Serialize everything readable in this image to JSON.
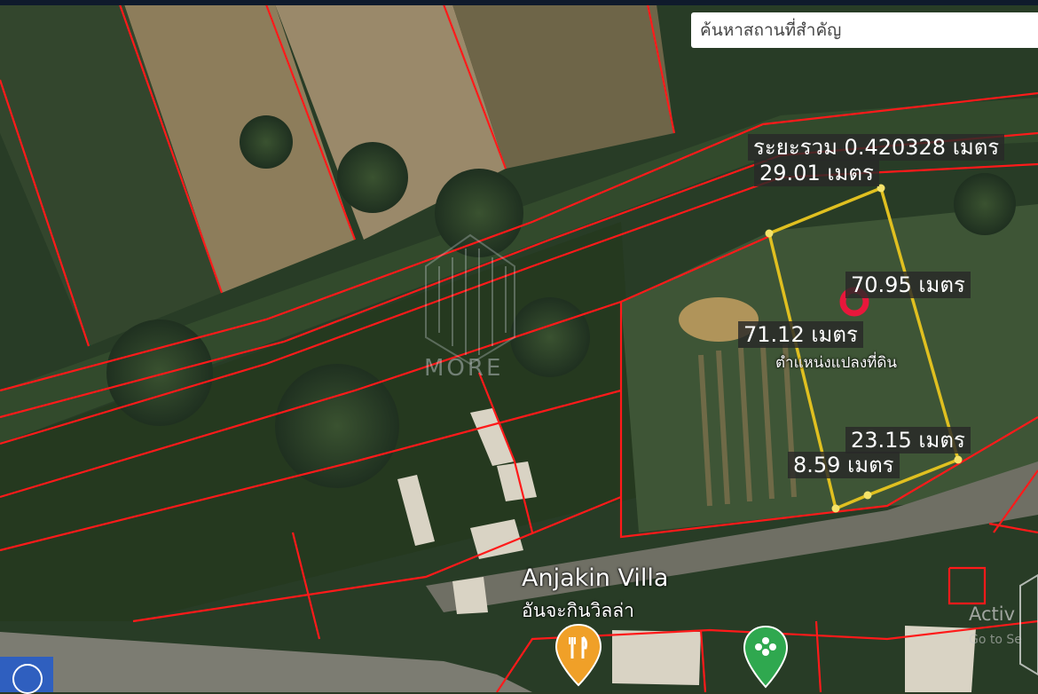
{
  "search": {
    "placeholder": "ค้นหาสถานที่สำคัญ"
  },
  "measurements": {
    "area_label": "ระยะรวม 0.420328 เมตร",
    "top_edge": "29.01 เมตร",
    "right_edge": "70.95 เมตร",
    "left_edge": "71.12 เมตร",
    "bottom_right": "23.15 เมตร",
    "bottom_left": "8.59 เมตร"
  },
  "marker": {
    "label": "ตำแหน่งแปลงที่ดิน",
    "color": "#e8173b"
  },
  "place": {
    "name_en": "Anjakin Villa",
    "name_th": "อันจะกินวิลล่า"
  },
  "watermark": {
    "text": "MORE"
  },
  "system": {
    "activate_line1": "Activ",
    "activate_line2": "Go to Se"
  },
  "colors": {
    "parcel_line": "#ff1a1a",
    "measure_line": "#e0c020",
    "vegetation": "#2c4128",
    "field": "#8a7c56"
  },
  "icons": {
    "restaurant_pin": "restaurant-pin-icon",
    "park_pin": "park-pin-icon",
    "location_button": "location-circle-icon"
  }
}
